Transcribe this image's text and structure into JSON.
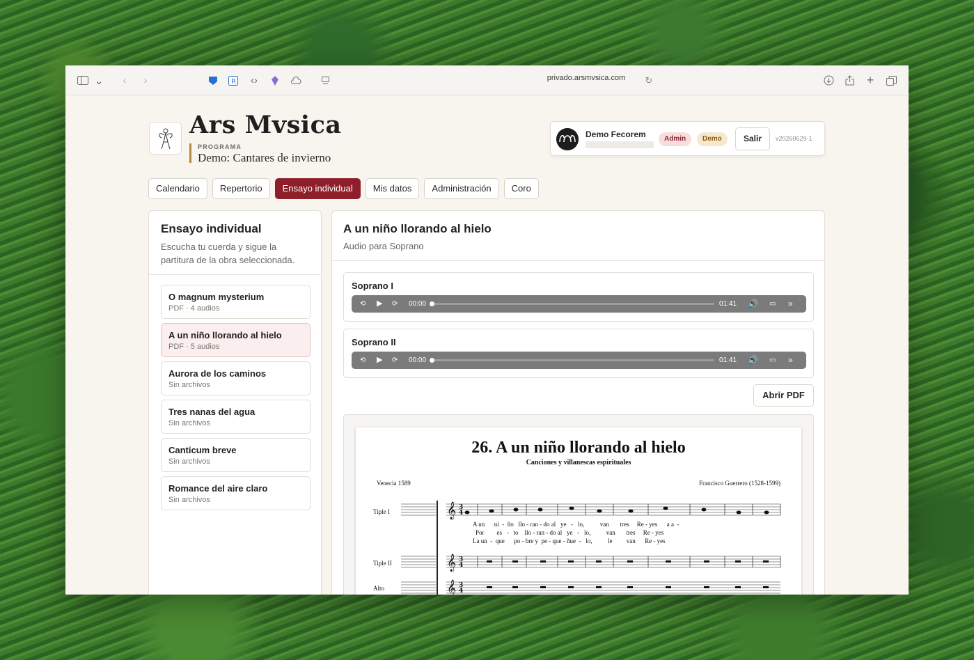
{
  "browser": {
    "url": "privado.arsmvsica.com"
  },
  "header": {
    "brand": "Ars Mvsica",
    "program_kicker": "PROGRAMA",
    "program_name": "Demo: Cantares de invierno"
  },
  "user": {
    "name": "Demo Fecorem",
    "avatar_text": "FECOREM",
    "badge_admin": "Admin",
    "badge_demo": "Demo",
    "logout_label": "Salir",
    "version": "v20260629-1"
  },
  "tabs": [
    {
      "label": "Calendario",
      "active": false
    },
    {
      "label": "Repertorio",
      "active": false
    },
    {
      "label": "Ensayo individual",
      "active": true
    },
    {
      "label": "Mis datos",
      "active": false
    },
    {
      "label": "Administración",
      "active": false
    },
    {
      "label": "Coro",
      "active": false
    }
  ],
  "sidebar": {
    "title": "Ensayo individual",
    "description": "Escucha tu cuerda y sigue la partitura de la obra seleccionada.",
    "works": [
      {
        "title": "O magnum mysterium",
        "meta": "PDF · 4 audios"
      },
      {
        "title": "A un niño llorando al hielo",
        "meta": "PDF · 5 audios"
      },
      {
        "title": "Aurora de los caminos",
        "meta": "Sin archivos"
      },
      {
        "title": "Tres nanas del agua",
        "meta": "Sin archivos"
      },
      {
        "title": "Canticum breve",
        "meta": "Sin archivos"
      },
      {
        "title": "Romance del aire claro",
        "meta": "Sin archivos"
      }
    ]
  },
  "main": {
    "title": "A un niño llorando al hielo",
    "subtitle": "Audio para Soprano",
    "audios": [
      {
        "label": "Soprano I",
        "current": "00:00",
        "duration": "01:41",
        "progress": 0
      },
      {
        "label": "Soprano II",
        "current": "00:00",
        "duration": "01:41",
        "progress": 0
      }
    ],
    "open_pdf_label": "Abrir PDF"
  },
  "score": {
    "title": "26. A un niño llorando al hielo",
    "subtitle": "Canciones y villanescas espirituales",
    "place": "Venecia 1589",
    "composer": "Francisco Guerrero (1528-1599)",
    "voices": [
      "Tiple I",
      "Tiple II",
      "Alto"
    ],
    "lyrics": [
      "A un      ni  -  ño   llo - ran - do al   ye   -   lo,          van       tres     Re - yes      a a  -",
      "Por        es   -   to    llo - ran - do al   ye   -   lo,          van       tres     Re - yes",
      "La un  -  que      po - bre y  pe - que - ñue  -   lo,          le         van      Re - yes"
    ]
  }
}
